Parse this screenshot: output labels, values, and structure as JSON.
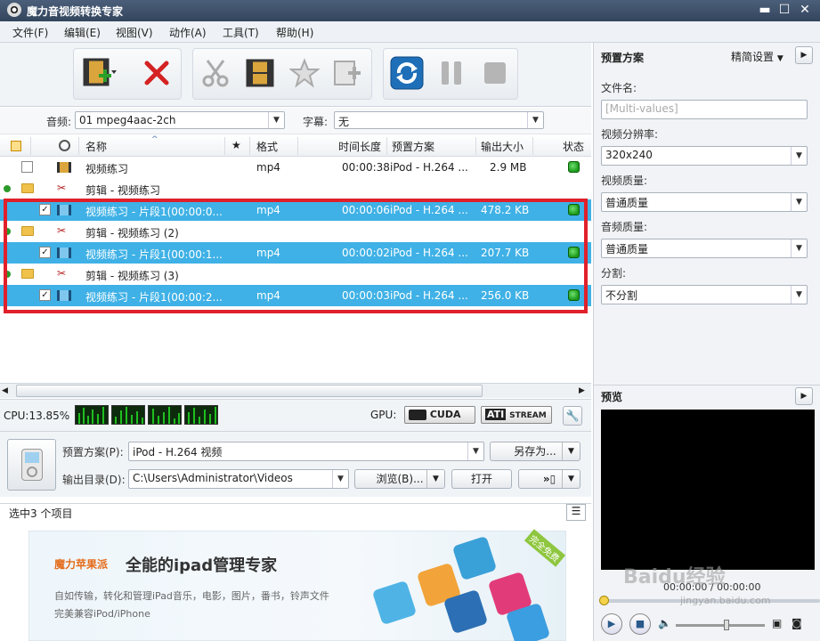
{
  "window": {
    "title": "魔力音视频转换专家",
    "min": "▬",
    "max": "☐",
    "close": "✕"
  },
  "menu": [
    "文件(F)",
    "编辑(E)",
    "视图(V)",
    "动作(A)",
    "工具(T)",
    "帮助(H)"
  ],
  "toolbar": {
    "icons": [
      "add-video-icon",
      "remove-icon",
      "cut-icon",
      "clip-film-icon",
      "star-icon",
      "merge-icon",
      "convert-icon",
      "pause-icon",
      "stop-icon"
    ]
  },
  "subtitle_row": {
    "audio_label": "音频:",
    "audio_value": "01 mpeg4aac-2ch",
    "subtitle_label": "字幕:",
    "subtitle_value": "无"
  },
  "table": {
    "columns": [
      "名称",
      "★",
      "格式",
      "时间长度",
      "预置方案",
      "输出大小",
      "状态"
    ],
    "rows": [
      {
        "type": "file",
        "checked": false,
        "name": "视频练习",
        "format": "mp4",
        "duration": "00:00:38",
        "preset": "iPod - H.264 ...",
        "size": "2.9 MB"
      },
      {
        "type": "group",
        "name": "剪辑 - 视频练习"
      },
      {
        "type": "clip",
        "checked": true,
        "name": "视频练习 - 片段1(00:00:0...",
        "format": "mp4",
        "duration": "00:00:06",
        "preset": "iPod - H.264 ...",
        "size": "478.2 KB"
      },
      {
        "type": "group",
        "name": "剪辑 - 视频练习 (2)"
      },
      {
        "type": "clip",
        "checked": true,
        "name": "视频练习 - 片段1(00:00:1...",
        "format": "mp4",
        "duration": "00:00:02",
        "preset": "iPod - H.264 ...",
        "size": "207.7 KB"
      },
      {
        "type": "group",
        "name": "剪辑 - 视频练习 (3)"
      },
      {
        "type": "clip",
        "checked": true,
        "name": "视频练习 - 片段1(00:00:2...",
        "format": "mp4",
        "duration": "00:00:03",
        "preset": "iPod - H.264 ...",
        "size": "256.0 KB"
      }
    ]
  },
  "status": {
    "cpu": "CPU:13.85%",
    "gpu_label": "GPU:",
    "cuda": "CUDA",
    "ati": "ATI",
    "stream": "STREAM"
  },
  "output": {
    "preset_label": "预置方案(P):",
    "preset_value": "iPod - H.264 视频",
    "save_as": "另存为...",
    "dir_label": "输出目录(D):",
    "dir_value": "C:\\Users\\Administrator\\Videos",
    "browse": "浏览(B)...",
    "open": "打开"
  },
  "selection_status": "选中3 个项目",
  "ad": {
    "brand": "魔力苹果派",
    "headline": "全能的ipad管理专家",
    "line1": "自如传输，转化和管理iPad音乐，电影，图片，番书，铃声文件",
    "line2": "完美兼容iPod/iPhone",
    "corner": "完全免费"
  },
  "right_panel": {
    "title": "预置方案",
    "mode": "精简设置",
    "filename_label": "文件名:",
    "filename_placeholder": "[Multi-values]",
    "resolution_label": "视频分辨率:",
    "resolution_value": "320x240",
    "video_quality_label": "视频质量:",
    "video_quality_value": "普通质量",
    "audio_quality_label": "音频质量:",
    "audio_quality_value": "普通质量",
    "split_label": "分割:",
    "split_value": "不分割"
  },
  "preview": {
    "title": "预览",
    "time": "00:00:00 / 00:00:00"
  },
  "watermark": {
    "brand": "Baidu经验",
    "url": "jingyan.baidu.com"
  }
}
